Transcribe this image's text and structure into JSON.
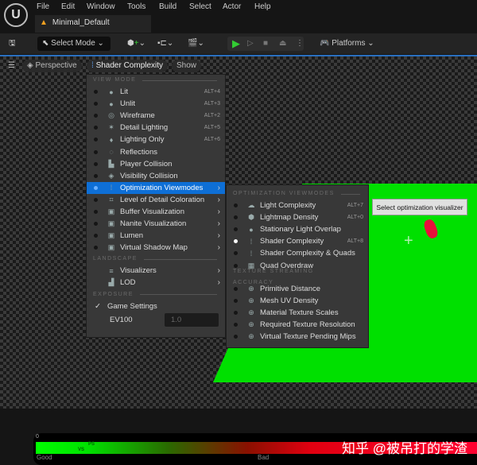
{
  "menu": [
    "File",
    "Edit",
    "Window",
    "Tools",
    "Build",
    "Select",
    "Actor",
    "Help"
  ],
  "tab": "Minimal_Default",
  "toolbar": {
    "select_mode": "Select Mode",
    "platforms": "Platforms"
  },
  "viewport_bar": {
    "perspective": "Perspective",
    "view_mode": "Shader Complexity",
    "show": "Show"
  },
  "view_menu": {
    "section_view_mode": "VIEW MODE",
    "items": [
      {
        "icon": "●",
        "label": "Lit",
        "shortcut": "ALT+4"
      },
      {
        "icon": "●",
        "label": "Unlit",
        "shortcut": "ALT+3"
      },
      {
        "icon": "◎",
        "label": "Wireframe",
        "shortcut": "ALT+2"
      },
      {
        "icon": "✶",
        "label": "Detail Lighting",
        "shortcut": "ALT+5"
      },
      {
        "icon": "♦",
        "label": "Lighting Only",
        "shortcut": "ALT+6"
      },
      {
        "icon": "◌",
        "label": "Reflections"
      },
      {
        "icon": "▙",
        "label": "Player Collision"
      },
      {
        "icon": "◈",
        "label": "Visibility Collision"
      },
      {
        "icon": "⁞",
        "label": "Optimization Viewmodes",
        "sub": true,
        "selected": true
      },
      {
        "icon": "⌗",
        "label": "Level of Detail Coloration",
        "sub": true
      },
      {
        "icon": "▣",
        "label": "Buffer Visualization",
        "sub": true
      },
      {
        "icon": "▣",
        "label": "Nanite Visualization",
        "sub": true
      },
      {
        "icon": "▣",
        "label": "Lumen",
        "sub": true
      },
      {
        "icon": "▣",
        "label": "Virtual Shadow Map",
        "sub": true
      }
    ],
    "section_landscape": "LANDSCAPE",
    "landscape": [
      {
        "icon": "≡",
        "label": "Visualizers"
      },
      {
        "icon": "▟",
        "label": "LOD"
      }
    ],
    "section_exposure": "EXPOSURE",
    "game_settings": "Game Settings",
    "ev100_label": "EV100",
    "ev100_value": "1.0"
  },
  "submenu": {
    "section_opt": "OPTIMIZATION VIEWMODES",
    "items": [
      {
        "icon": "☁",
        "label": "Light Complexity",
        "shortcut": "ALT+7"
      },
      {
        "icon": "⬢",
        "label": "Lightmap Density",
        "shortcut": "ALT+0"
      },
      {
        "icon": "●",
        "label": "Stationary Light Overlap"
      },
      {
        "icon": "⁞",
        "label": "Shader Complexity",
        "shortcut": "ALT+8",
        "active": true
      },
      {
        "icon": "⁞",
        "label": "Shader Complexity & Quads"
      },
      {
        "icon": "▦",
        "label": "Quad Overdraw"
      }
    ],
    "section_tex": "TEXTURE STREAMING ACCURACY",
    "tex": [
      {
        "icon": "⊕",
        "label": "Primitive Distance"
      },
      {
        "icon": "⊕",
        "label": "Mesh UV Density"
      },
      {
        "icon": "⊕",
        "label": "Material Texture Scales"
      },
      {
        "icon": "⊕",
        "label": "Required Texture Resolution"
      },
      {
        "icon": "⊕",
        "label": "Virtual Texture Pending Mips"
      }
    ]
  },
  "tooltip": "Select optimization visualizer",
  "legend": {
    "zero": "0",
    "ps": "PS",
    "vs": "VS",
    "good": "Good",
    "bad": "Bad"
  },
  "watermark": "知乎 @被吊打的学渣"
}
